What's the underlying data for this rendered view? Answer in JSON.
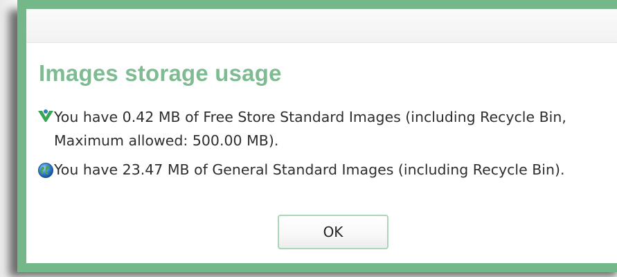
{
  "dialog": {
    "heading": "Images storage usage",
    "messages": [
      {
        "icon": "free-store-icon",
        "text": "You have 0.42 MB of Free Store Standard Images (including Recycle Bin, Maximum allowed: 500.00 MB)."
      },
      {
        "icon": "globe-icon",
        "text": "You have 23.47 MB of General Standard Images (including Recycle Bin)."
      }
    ],
    "ok_label": "OK"
  },
  "colors": {
    "border": "#74b88a",
    "heading": "#7fbb92",
    "button_border": "#a9d6b4"
  }
}
